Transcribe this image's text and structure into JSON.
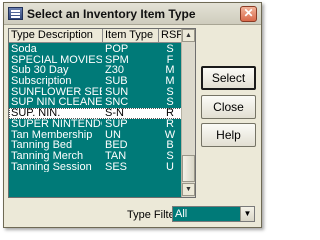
{
  "window": {
    "title": "Select an Inventory Item Type",
    "close_glyph": "✕"
  },
  "list": {
    "columns": [
      "Type Description",
      "Item Type",
      "RSF"
    ],
    "rows": [
      {
        "desc": "Soda",
        "type": "POP",
        "rsf": "S",
        "selected": false
      },
      {
        "desc": "SPECIAL MOVIES",
        "type": "SPM",
        "rsf": "F",
        "selected": false
      },
      {
        "desc": "Sub 30 Day",
        "type": "Z30",
        "rsf": "M",
        "selected": false
      },
      {
        "desc": "Subscription",
        "type": "SUB",
        "rsf": "M",
        "selected": false
      },
      {
        "desc": "SUNFLOWER SEE",
        "type": "SUN",
        "rsf": "S",
        "selected": false
      },
      {
        "desc": "SUP NIN CLEANER",
        "type": "SNC",
        "rsf": "S",
        "selected": false
      },
      {
        "desc": "SUP. NIN.",
        "type": "S-N",
        "rsf": "R",
        "selected": true
      },
      {
        "desc": "SUPER NINTENDO",
        "type": "SUP",
        "rsf": "R",
        "selected": false
      },
      {
        "desc": "Tan Membership",
        "type": "UN",
        "rsf": "W",
        "selected": false
      },
      {
        "desc": "Tanning Bed",
        "type": "BED",
        "rsf": "B",
        "selected": false
      },
      {
        "desc": "Tanning Merch",
        "type": "TAN",
        "rsf": "S",
        "selected": false
      },
      {
        "desc": "Tanning Session",
        "type": "SES",
        "rsf": "U",
        "selected": false
      }
    ],
    "scroll_up_glyph": "▲",
    "scroll_down_glyph": "▼"
  },
  "buttons": {
    "select": "Select",
    "close": "Close",
    "help": "Help"
  },
  "filter": {
    "label": "Type Filter:",
    "value": "All",
    "arrow_glyph": "▼"
  },
  "colors": {
    "list_background": "#007a78",
    "list_text": "#ffffff",
    "selected_row": "#ffffff"
  }
}
